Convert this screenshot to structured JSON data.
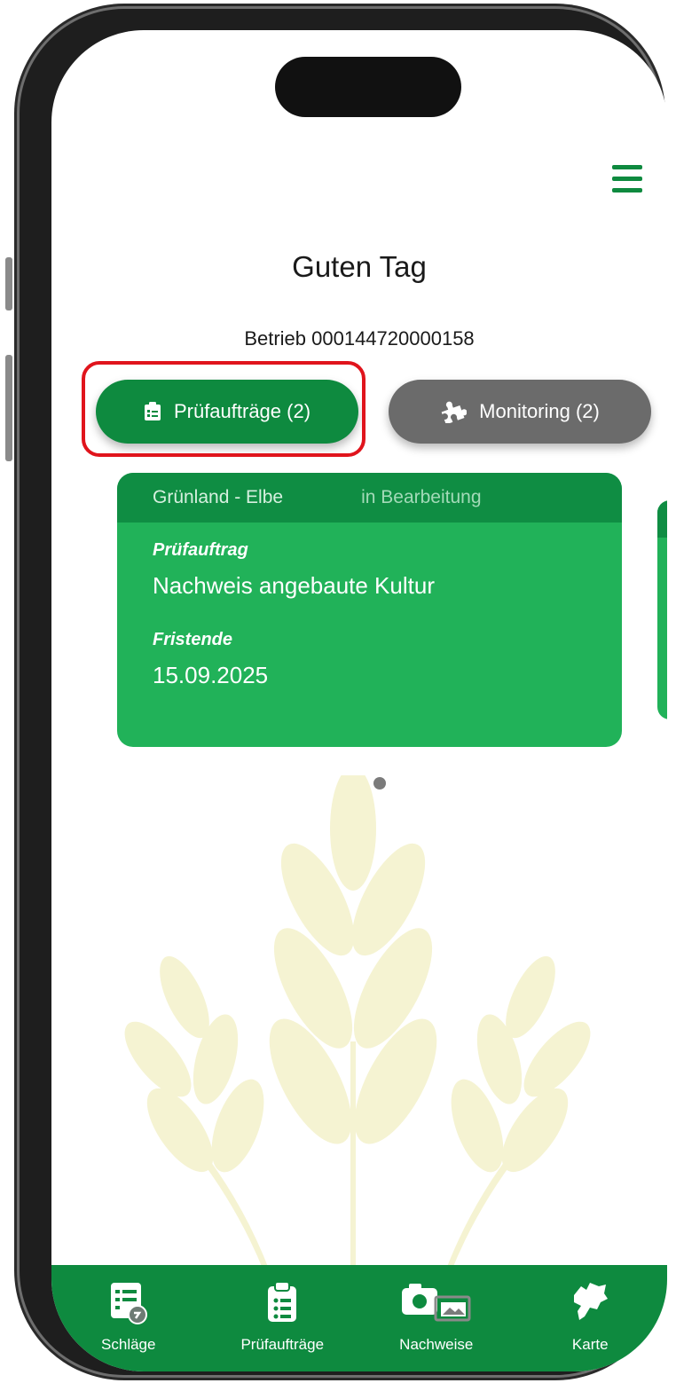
{
  "header": {
    "greeting": "Guten Tag",
    "betrieb": "Betrieb 000144720000158"
  },
  "tabs": [
    {
      "label": "Prüfaufträge (2)",
      "icon": "clipboard-icon",
      "active": true
    },
    {
      "label": "Monitoring (2)",
      "icon": "puzzle-icon",
      "active": false
    }
  ],
  "card": {
    "region": "Grünland - Elbe",
    "status": "in Bearbeitung",
    "type_label": "Prüfauftrag",
    "type_value": "Nachweis angebaute Kultur",
    "deadline_label": "Fristende",
    "deadline_value": "15.09.2025"
  },
  "carousel": {
    "total": 2,
    "current": 1
  },
  "bottom_nav": [
    {
      "label": "Schläge",
      "icon": "fields-list-icon"
    },
    {
      "label": "Prüfaufträge",
      "icon": "clipboard-list-icon"
    },
    {
      "label": "Nachweise",
      "icon": "camera-gallery-icon"
    },
    {
      "label": "Karte",
      "icon": "map-icon"
    }
  ],
  "colors": {
    "primary_green": "#0e8a3f",
    "card_green": "#21b259",
    "card_header_green": "#0f8d43",
    "inactive_tab": "#6b6b6b",
    "highlight_red": "#e0141c",
    "wheat": "#f5f3d2"
  }
}
